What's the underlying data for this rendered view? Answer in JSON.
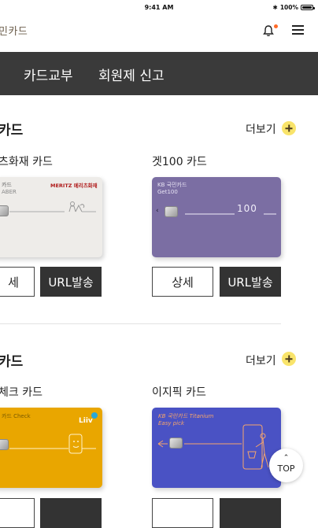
{
  "status": {
    "time": "9:41 AM",
    "battery": "100%"
  },
  "header": {
    "brand": "민카드"
  },
  "nav": {
    "items": [
      "카드교부",
      "회원제 신고"
    ]
  },
  "sections": [
    {
      "title": "카드",
      "more_label": "더보기",
      "cards": [
        {
          "name": "츠화재 카드",
          "card_text_top": "카드",
          "card_text_sub": "ABER",
          "card_logo": "MERITZ 메리츠화재",
          "detail_label": "세",
          "url_label": "URL발송"
        },
        {
          "name": "겟100 카드",
          "card_text_top": "KB 국민카드",
          "card_text_sub": "Get100",
          "card_logo": "100",
          "detail_label": "상세",
          "url_label": "URL발송"
        }
      ]
    },
    {
      "title": "카드",
      "more_label": "더보기",
      "cards": [
        {
          "name": "체크 카드",
          "card_text_top": "카드  Check",
          "card_logo": "Liiv",
          "detail_label": "",
          "url_label": ""
        },
        {
          "name": "이지픽 카드",
          "card_text_top": "KB 국민카드  Titanium",
          "card_text_sub": "Easy pick",
          "detail_label": "",
          "url_label": ""
        }
      ]
    }
  ],
  "top_button": {
    "label": "TOP"
  },
  "colors": {
    "nav_bg": "#3a3a3a",
    "accent_yellow": "#f9e46b",
    "notification_dot": "#ff6a28",
    "card_purple": "#7b6ea3",
    "card_yellow": "#e9a600",
    "card_blue": "#4a52c4"
  }
}
